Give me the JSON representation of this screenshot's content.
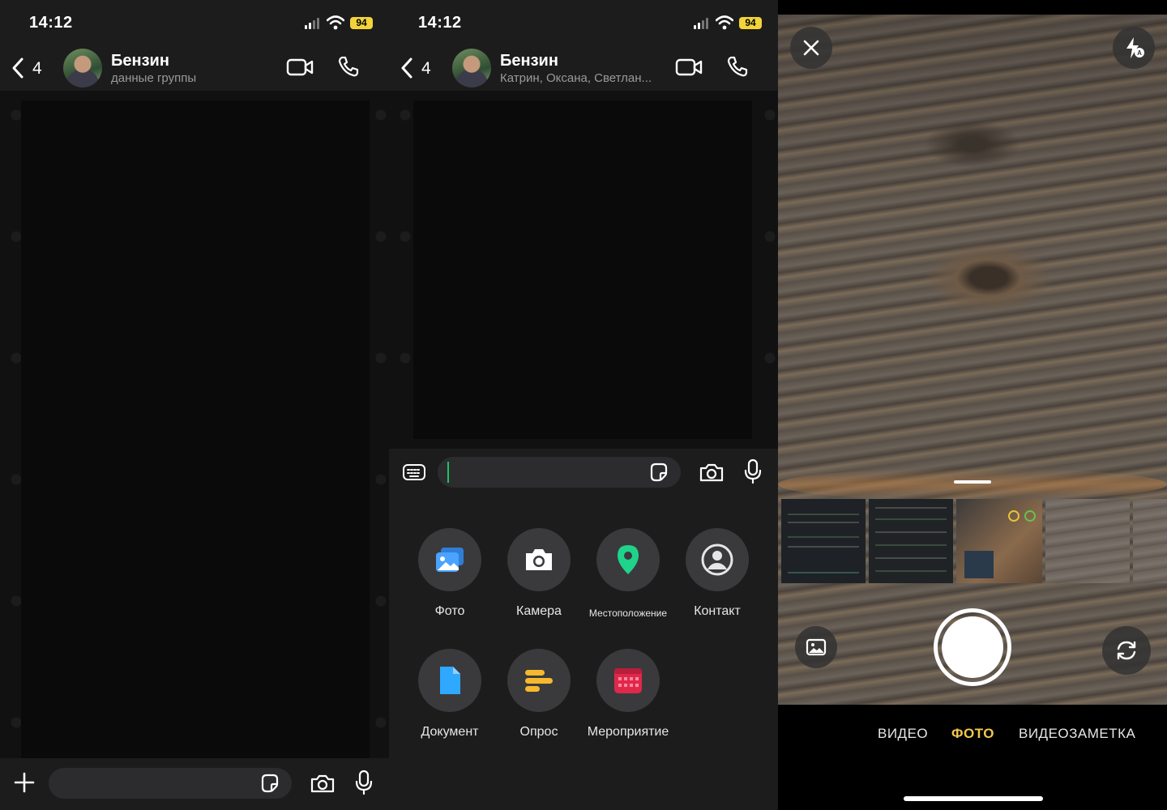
{
  "status": {
    "time": "14:12",
    "battery": "94"
  },
  "chat": {
    "name": "Бензин",
    "back_count": "4",
    "subtitle_panel1": "данные группы",
    "subtitle_panel2": "Катрин, Оксана, Светлан..."
  },
  "attach": {
    "items": [
      {
        "label": "Фото",
        "icon": "photo-icon",
        "color": "#4aa3ff"
      },
      {
        "label": "Камера",
        "icon": "camera-icon",
        "color": "#ffffff"
      },
      {
        "label": "Местоположение",
        "icon": "location-pin-icon",
        "color": "#1fd38a"
      },
      {
        "label": "Контакт",
        "icon": "contact-icon",
        "color": "#e6e6e6"
      },
      {
        "label": "Документ",
        "icon": "document-icon",
        "color": "#2fa8ff"
      },
      {
        "label": "Опрос",
        "icon": "poll-icon",
        "color": "#f5b82e"
      },
      {
        "label": "Мероприятие",
        "icon": "event-calendar-icon",
        "color": "#e0284b"
      }
    ]
  },
  "camera": {
    "modes": [
      "ВИДЕО",
      "ФОТО",
      "ВИДЕОЗАМЕТКА"
    ],
    "active_mode": "ФОТО"
  },
  "colors": {
    "accent_green": "#21c063",
    "battery_yellow": "#f2d33a",
    "active_mode": "#f2c94c"
  }
}
